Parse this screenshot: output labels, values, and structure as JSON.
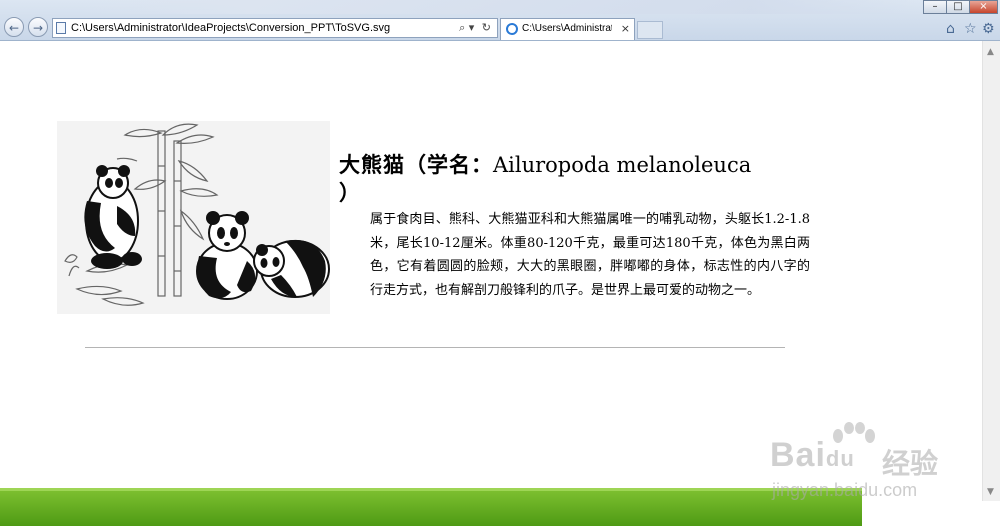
{
  "browser": {
    "address_url": "C:\\Users\\Administrator\\IdeaProjects\\Conversion_PPT\\ToSVG.svg",
    "tab_title": "C:\\Users\\Administrator\\I...",
    "nav_back": "←",
    "nav_forward": "→",
    "search_icon": "⌕ ▾",
    "refresh_icon": "↻",
    "tab_close": "×",
    "window_minimize": "–",
    "window_maximize": "□",
    "window_close": "×",
    "home_icon": "⌂",
    "favorites_icon": "☆",
    "tools_icon": "⚙",
    "icon_names": [
      "back-icon",
      "forward-icon",
      "page-icon",
      "search-icon",
      "refresh-icon",
      "ie-icon",
      "close-icon",
      "home-icon",
      "star-icon",
      "gear-icon"
    ]
  },
  "content": {
    "headline_cn": "大熊猫（学名：",
    "headline_latin": "Ailuropoda melanoleuca",
    "headline_close": "）",
    "description": "属于食肉目、熊科、大熊猫亚科和大熊猫属唯一的哺乳动物，头躯长1.2-1.8米，尾长10-12厘米。体重80-120千克，最重可达180千克，体色为黑白两色，它有着圆圆的脸颊，大大的黑眼圈，胖嘟嘟的身体，标志性的内八字的行走方式，也有解剖刀般锋利的爪子。是世界上最可爱的动物之一。"
  },
  "watermark": {
    "brand": "Bai",
    "brand2": "du",
    "cn": "经验",
    "url": "jingyan.baidu.com"
  },
  "colors": {
    "footer_green": "#5aa81a",
    "chrome_blue": "#c9d7e9"
  }
}
